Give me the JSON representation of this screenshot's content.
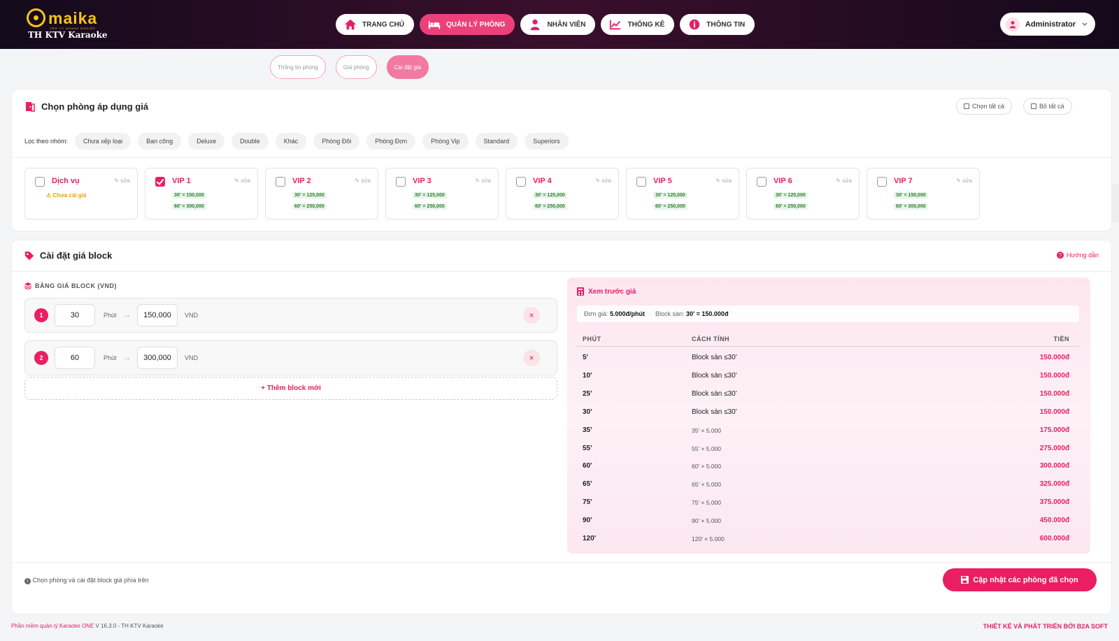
{
  "brand": {
    "logo_word": "maika",
    "logo_tagline": "TRỢ LÝ DOANH NGHIỆP",
    "subtitle": "TH KTV Karaoke"
  },
  "nav": [
    {
      "label": "TRANG CHỦ",
      "icon": "home-icon",
      "active": false
    },
    {
      "label": "QUẢN LÝ PHÒNG",
      "icon": "bed-icon",
      "active": true
    },
    {
      "label": "NHÂN VIÊN",
      "icon": "user-icon",
      "active": false
    },
    {
      "label": "THỐNG KÊ",
      "icon": "chart-icon",
      "active": false
    },
    {
      "label": "THÔNG TIN",
      "icon": "info-icon",
      "active": false
    }
  ],
  "user": {
    "name": "Administrator"
  },
  "subtabs": [
    {
      "label": "Thông tin phòng",
      "active": false
    },
    {
      "label": "Giá phòng",
      "active": false
    },
    {
      "label": "Cài đặt giá",
      "active": true
    }
  ],
  "room_select": {
    "title": "Chọn phòng áp dụng giá",
    "select_all": "Chọn tất cả",
    "deselect_all": "Bỏ tất cả",
    "filter_label": "Lọc theo nhóm:",
    "filters": [
      "Chưa xếp loại",
      "Ban công",
      "Deluxe",
      "Double",
      "Khác",
      "Phòng Đôi",
      "Phòng Đơn",
      "Phòng Vip",
      "Standard",
      "Superiors"
    ],
    "edit_label": "sửa",
    "rooms": [
      {
        "name": "Dịch vụ",
        "checked": false,
        "warning": "Chưa cài giá",
        "prices": []
      },
      {
        "name": "VIP 1",
        "checked": true,
        "prices": [
          "30' = 150,000",
          "60' = 300,000"
        ]
      },
      {
        "name": "VIP 2",
        "checked": false,
        "prices": [
          "30' = 125,000",
          "60' = 250,000"
        ]
      },
      {
        "name": "VIP 3",
        "checked": false,
        "prices": [
          "30' = 125,000",
          "60' = 250,000"
        ]
      },
      {
        "name": "VIP 4",
        "checked": false,
        "prices": [
          "30' = 125,000",
          "60' = 250,000"
        ]
      },
      {
        "name": "VIP 5",
        "checked": false,
        "prices": [
          "30' = 125,000",
          "60' = 250,000"
        ]
      },
      {
        "name": "VIP 6",
        "checked": false,
        "prices": [
          "30' = 125,000",
          "60' = 250,000"
        ]
      },
      {
        "name": "VIP 7",
        "checked": false,
        "prices": [
          "30' = 150,000",
          "60' = 300,000"
        ]
      }
    ]
  },
  "block_settings": {
    "title": "Cài đặt giá block",
    "help": "Hướng dẫn",
    "table_label": "BẢNG GIÁ BLOCK (VND)",
    "minute_unit": "Phút",
    "currency": "VND",
    "blocks": [
      {
        "index": "1",
        "minutes": "30",
        "price": "150,000"
      },
      {
        "index": "2",
        "minutes": "60",
        "price": "300,000"
      }
    ],
    "add_label": "+ Thêm block mới",
    "footer_note": "Chọn phòng và cài đặt block giá phía trên",
    "update_button": "Cập nhật các phòng đã chọn"
  },
  "preview": {
    "title": "Xem trước giá",
    "unit_label": "Đơn giá:",
    "unit_value": "5.000đ/phút",
    "floor_label": "Block sàn:",
    "floor_value": "30' = 150.000đ",
    "headers": [
      "PHÚT",
      "CÁCH TÍNH",
      "TIỀN"
    ],
    "rows": [
      {
        "minutes": "5'",
        "method": "Block sàn ≤30'",
        "amount": "150.000đ",
        "floor": true
      },
      {
        "minutes": "10'",
        "method": "Block sàn ≤30'",
        "amount": "150.000đ",
        "floor": true
      },
      {
        "minutes": "25'",
        "method": "Block sàn ≤30'",
        "amount": "150.000đ",
        "floor": true
      },
      {
        "minutes": "30'",
        "method": "Block sàn ≤30'",
        "amount": "150.000đ",
        "floor": true
      },
      {
        "minutes": "35'",
        "method": "35' × 5.000",
        "amount": "175.000đ",
        "floor": false
      },
      {
        "minutes": "55'",
        "method": "55' × 5.000",
        "amount": "275.000đ",
        "floor": false
      },
      {
        "minutes": "60'",
        "method": "60' × 5.000",
        "amount": "300.000đ",
        "floor": false
      },
      {
        "minutes": "65'",
        "method": "65' × 5.000",
        "amount": "325.000đ",
        "floor": false
      },
      {
        "minutes": "75'",
        "method": "75' × 5.000",
        "amount": "375.000đ",
        "floor": false
      },
      {
        "minutes": "90'",
        "method": "90' × 5.000",
        "amount": "450.000đ",
        "floor": false
      },
      {
        "minutes": "120'",
        "method": "120' × 5.000",
        "amount": "600.000đ",
        "floor": false
      }
    ]
  },
  "footer": {
    "left_pink": "Phần mềm quản lý Karaoke ONE",
    "left_rest": " V 16.3.0 - TH KTV Karaoke",
    "right": "THIẾT KẾ VÀ PHÁT TRIỂN BỞI B2A SOFT"
  },
  "colors": {
    "accent": "#e91e63",
    "header_bg": "#2a0d22",
    "price_green": "#2e7d32",
    "warning": "#e6a000"
  }
}
